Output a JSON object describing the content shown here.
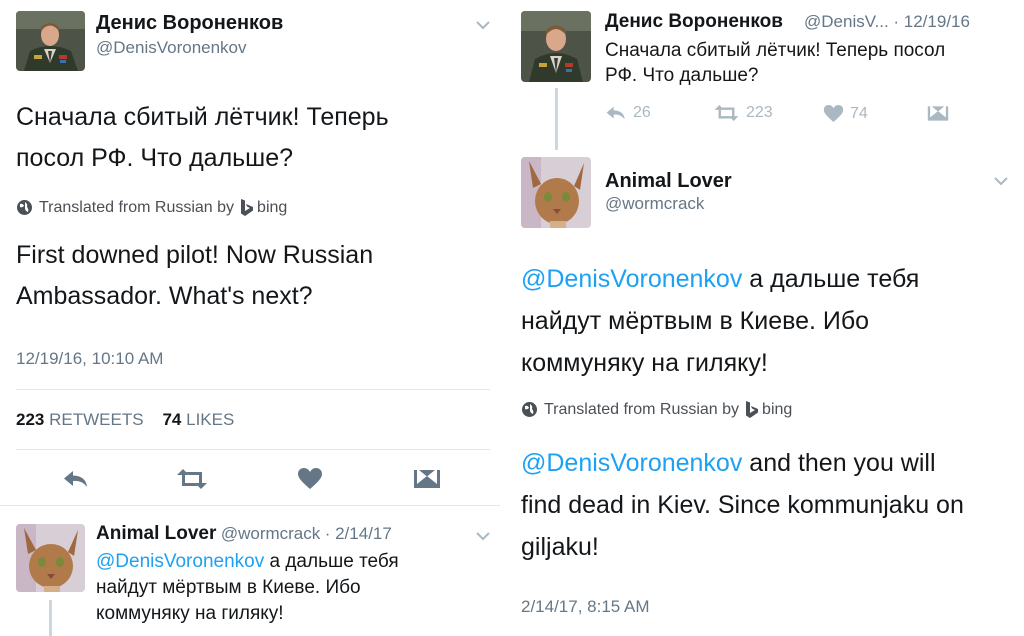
{
  "left_panel": {
    "main_tweet": {
      "display_name": "Денис Вороненков",
      "handle": "@DenisVoronenkov",
      "text_line1": "Сначала сбитый лётчик! Теперь",
      "text_line2": "посол РФ. Что дальше?",
      "translated_label": "Translated from Russian by",
      "bing_label": "bing",
      "translation_line1": "First downed pilot! Now Russian",
      "translation_line2": "Ambassador. What's next?",
      "timestamp": "12/19/16, 10:10 AM",
      "retweets_count": "223",
      "retweets_label": "RETWEETS",
      "likes_count": "74",
      "likes_label": "LIKES"
    },
    "reply": {
      "display_name": "Animal Lover",
      "handle": "@wormcrack",
      "date": "· 2/14/17",
      "mention": "@DenisVoronenkov",
      "text_line1_rest": " а дальше тебя",
      "text_line2": "найдут мёртвым в Киеве. Ибо",
      "text_line3": "коммуняку на гиляку!"
    }
  },
  "right_panel": {
    "original": {
      "display_name": "Денис Вороненков",
      "handle_date": "@DenisV... · 12/19/16",
      "text_line1": "Сначала сбитый лётчик! Теперь посол",
      "text_line2": "РФ. Что дальше?",
      "reply_count": "26",
      "retweet_count": "223",
      "like_count": "74"
    },
    "reply_tweet": {
      "display_name": "Animal Lover",
      "handle": "@wormcrack",
      "mention": "@DenisVoronenkov",
      "text_line1_rest": " а дальше тебя",
      "text_line2": "найдут мёртвым в Киеве. Ибо",
      "text_line3": "коммуняку на гиляку!",
      "translated_label": "Translated from Russian by",
      "bing_label": "bing",
      "translation_mention": "@DenisVoronenkov",
      "translation_line1_rest": " and then you will",
      "translation_line2": "find dead in Kiev. Since kommunjaku on",
      "translation_line3": "giljaku!",
      "timestamp": "2/14/17, 8:15 AM"
    }
  },
  "colors": {
    "link_blue": "#1da1f2",
    "secondary_gray": "#657786",
    "icon_gray": "#aab8c2",
    "action_gray": "#657786",
    "divider": "#e1e8ed"
  },
  "icons": [
    "chevron-down-icon",
    "globe-icon",
    "bing-logo-icon",
    "reply-icon",
    "retweet-icon",
    "heart-icon",
    "message-icon"
  ]
}
